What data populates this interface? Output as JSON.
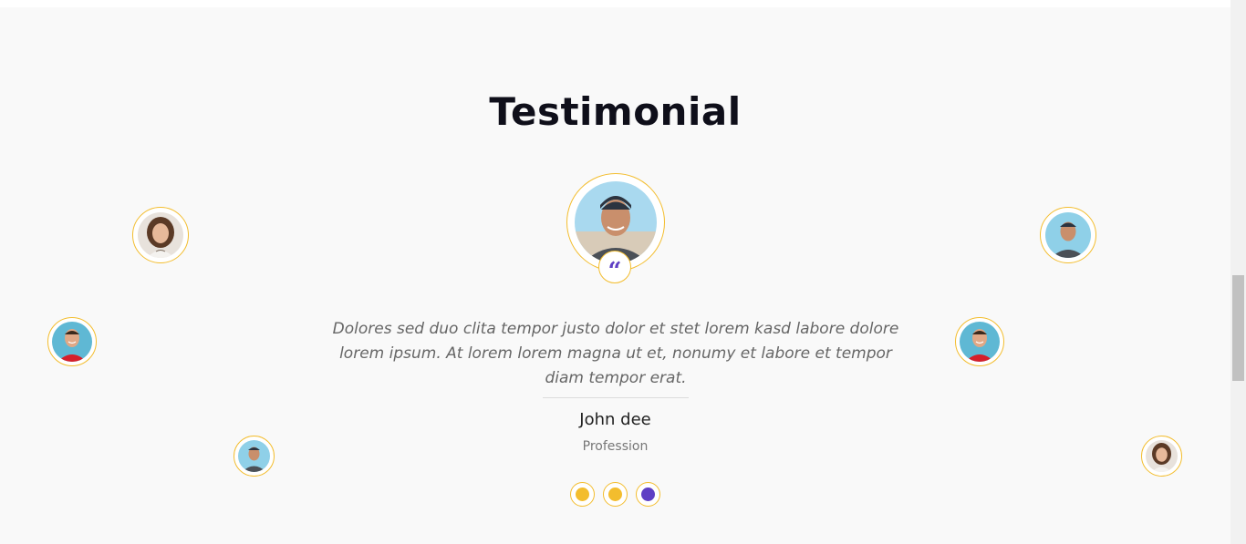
{
  "section": {
    "title": "Testimonial"
  },
  "testimonial": {
    "quote": "Dolores sed duo clita tempor justo dolor et stet lorem kasd labore dolore lorem ipsum. At lorem lorem magna ut et, nonumy et labore et tempor diam tempor erat.",
    "name": "John dee",
    "profession": "Profession",
    "quote_icon": "quote-icon"
  },
  "carousel": {
    "active_index": 2,
    "dot_count": 3
  },
  "colors": {
    "accent_yellow": "#f3bd2e",
    "accent_purple": "#5e3fc4",
    "background": "#f9f9f9",
    "title": "#0f0f1a"
  }
}
